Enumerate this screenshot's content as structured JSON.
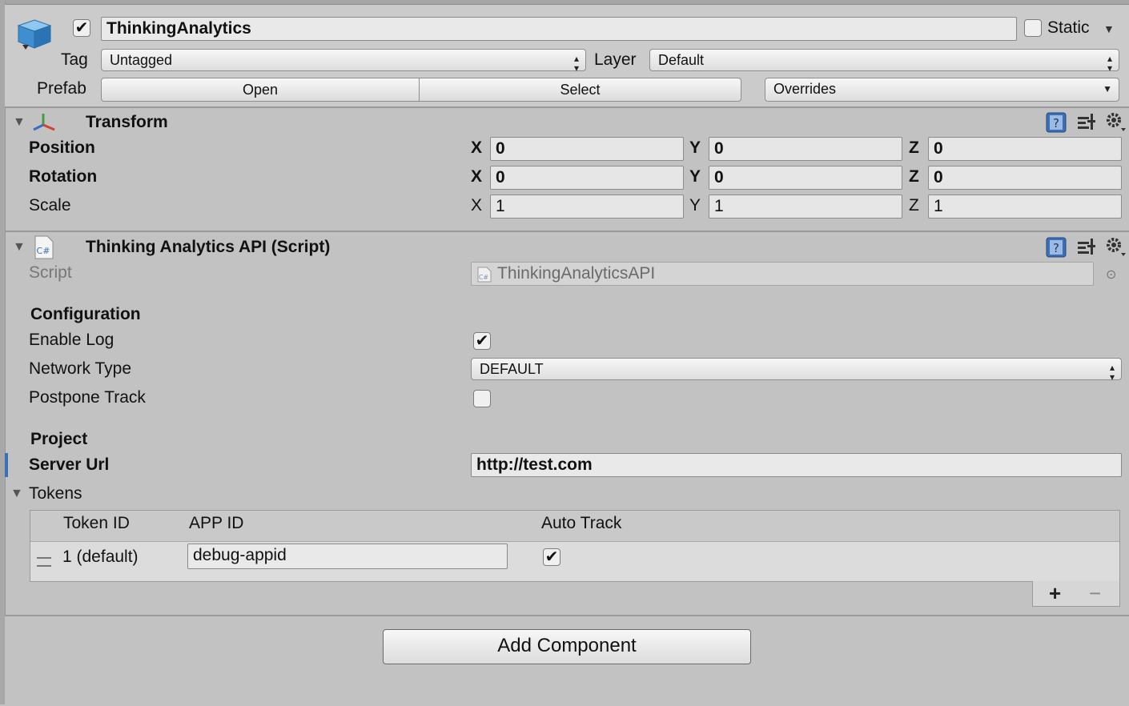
{
  "header": {
    "name": "ThinkingAnalytics",
    "active_checked": true,
    "static_label": "Static",
    "static_checked": false,
    "tag_label": "Tag",
    "tag_value": "Untagged",
    "layer_label": "Layer",
    "layer_value": "Default",
    "prefab_label": "Prefab",
    "open_label": "Open",
    "select_label": "Select",
    "overrides_label": "Overrides"
  },
  "transform": {
    "title": "Transform",
    "rows": [
      {
        "label": "Position",
        "x": "0",
        "y": "0",
        "z": "0"
      },
      {
        "label": "Rotation",
        "x": "0",
        "y": "0",
        "z": "0"
      },
      {
        "label": "Scale",
        "x": "1",
        "y": "1",
        "z": "1"
      }
    ],
    "axes": {
      "x": "X",
      "y": "Y",
      "z": "Z"
    }
  },
  "script_component": {
    "title": "Thinking Analytics API (Script)",
    "script_label": "Script",
    "script_value": "ThinkingAnalyticsAPI",
    "configuration_header": "Configuration",
    "enable_log_label": "Enable Log",
    "enable_log_checked": true,
    "network_type_label": "Network Type",
    "network_type_value": "DEFAULT",
    "postpone_track_label": "Postpone Track",
    "postpone_track_checked": false,
    "project_header": "Project",
    "server_url_label": "Server Url",
    "server_url_value": "http://test.com",
    "tokens_label": "Tokens",
    "tokens_table": {
      "columns": [
        "Token ID",
        "APP ID",
        "Auto Track"
      ],
      "rows": [
        {
          "token_id": "1 (default)",
          "app_id": "debug-appid",
          "auto_track": true
        }
      ]
    }
  },
  "icons": {
    "cs_text": "C#"
  },
  "footer": {
    "add_component_label": "Add Component"
  },
  "colors": {
    "accent_blue": "#3d6fb4",
    "background": "#c2c2c2"
  }
}
